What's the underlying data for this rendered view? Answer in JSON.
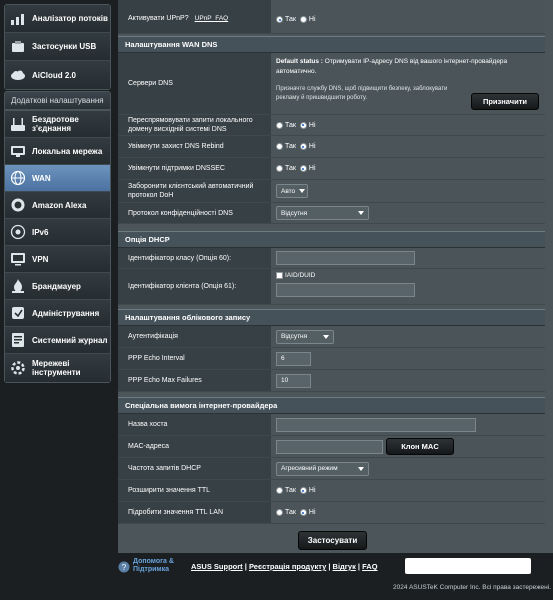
{
  "sidebar": {
    "top_items": [
      {
        "label": "Аналізатор потоків",
        "icon": "traffic-analyzer-icon"
      },
      {
        "label": "Застосунки USB",
        "icon": "usb-icon"
      },
      {
        "label": "AiCloud 2.0",
        "icon": "cloud-icon"
      }
    ],
    "advanced_header": "Додаткові налаштування",
    "advanced_items": [
      {
        "label": "Бездротове з'єднання",
        "icon": "wireless-icon"
      },
      {
        "label": "Локальна мережа",
        "icon": "lan-icon"
      },
      {
        "label": "WAN",
        "icon": "globe-icon",
        "active": true
      },
      {
        "label": "Amazon Alexa",
        "icon": "alexa-icon"
      },
      {
        "label": "IPv6",
        "icon": "ipv6-icon"
      },
      {
        "label": "VPN",
        "icon": "vpn-icon"
      },
      {
        "label": "Брандмауер",
        "icon": "firewall-icon"
      },
      {
        "label": "Адміністрування",
        "icon": "admin-icon"
      },
      {
        "label": "Системний журнал",
        "icon": "syslog-icon"
      },
      {
        "label": "Мережеві інструменти",
        "icon": "network-tools-icon"
      }
    ]
  },
  "upnp": {
    "label": "Активувати UPnP?",
    "faq_link": "UPnP_FAQ",
    "options": [
      "Так",
      "Ні"
    ]
  },
  "wan_dns": {
    "title": "Налаштування WAN DNS",
    "dns_servers_label": "Сервери DNS",
    "default_status_bold": "Default status :",
    "default_status_text": "Отримувати IP-адресу DNS від вашого інтернет-провайдера автоматично.",
    "hint_text": "Призначте службу DNS, щоб підвищити безпеку, заблокувати рекламу й пришвидшити роботу.",
    "assign_button": "Призначити",
    "redirect_label": "Переспрямовувати запити локального домену висхідній системі DNS",
    "rebind_label": "Увімкнути захист DNS Rebind",
    "dnssec_label": "Увімкнути підтримки DNSSEC",
    "doh_label": "Заборонити клієнтський автоматичний протокол DoH",
    "doh_value": "Авто",
    "privacy_label": "Протокол конфіденційності DNS",
    "privacy_value": "Відсутня",
    "options": [
      "Так",
      "Ні"
    ]
  },
  "dhcp": {
    "title": "Опція DHCP",
    "class_id_label": "Ідентифікатор класу (Опція 60):",
    "client_id_label": "Ідентифікатор клієнта (Опція 61):",
    "iaid_label": "IAID/DUID"
  },
  "account": {
    "title": "Налаштування облікового запису",
    "auth_label": "Аутентифікація",
    "auth_value": "Відсутня",
    "echo_interval_label": "PPP Echo Interval",
    "echo_interval_value": "6",
    "echo_failures_label": "PPP Echo Max Failures",
    "echo_failures_value": "10"
  },
  "isp": {
    "title": "Спеціальна вимога інтернет-провайдера",
    "hostname_label": "Назва хоста",
    "mac_label": "MAC-адреса",
    "clone_mac_button": "Клон MAC",
    "dhcp_freq_label": "Частота запитів DHCP",
    "dhcp_freq_value": "Агресивний режим",
    "extend_ttl_label": "Розширити значення TTL",
    "spoof_ttl_label": "Підробити значення TTL LAN",
    "options": [
      "Так",
      "Ні"
    ]
  },
  "apply_button": "Застосувати",
  "footer": {
    "help_label": "Допомога & Підтримка",
    "links": [
      "ASUS Support",
      "Реєстрація продукту",
      "Відгук",
      "FAQ"
    ],
    "copyright": "2024 ASUSTeK Computer Inc. Всі права застережені."
  }
}
